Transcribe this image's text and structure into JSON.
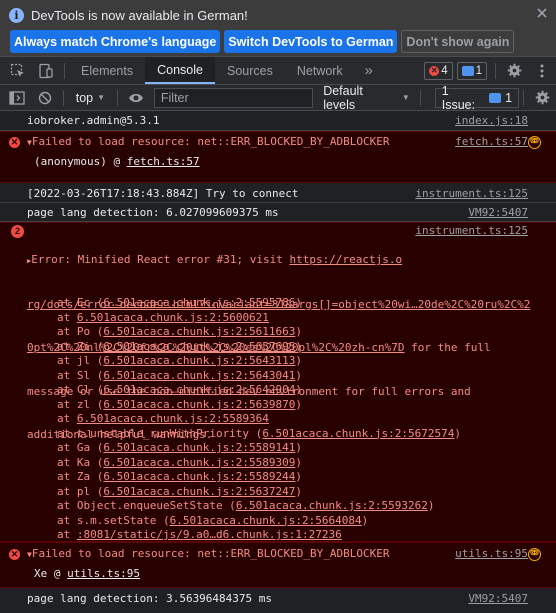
{
  "infobar": {
    "message": "DevTools is now available in German!",
    "buttons": [
      "Always match Chrome's language",
      "Switch DevTools to German",
      "Don't show again"
    ]
  },
  "tabs": [
    "Elements",
    "Console",
    "Sources",
    "Network"
  ],
  "badges": {
    "errors": "4",
    "messages": "1"
  },
  "toolbar": {
    "context": "top",
    "filter_placeholder": "Filter",
    "levels": "Default levels",
    "issues_label": "1 Issue:",
    "issues_count": "1"
  },
  "messages": {
    "m1": {
      "text": "iobroker.admin@5.3.1",
      "src": "index.js:18"
    },
    "m2": {
      "text": "Failed to load resource: net::ERR_BLOCKED_BY_ADBLOCKER",
      "src": "fetch.ts:57",
      "line2a": "(anonymous) @ ",
      "line2b": "fetch.ts:57"
    },
    "m3": {
      "text": "[2022-03-26T17:18:43.884Z] Try to connect",
      "src": "instrument.ts:125"
    },
    "m4": {
      "text": "page lang detection: 6.027099609375 ms",
      "src": "VM92:5407"
    },
    "m5": {
      "count": "2",
      "prefix": "Error: Minified React error #31; visit ",
      "url1": "https://reactjs.o",
      "src": "instrument.ts:125",
      "url2": "rg/docs/error-decoder.html?invariant=31&args[]=object%20wi…20de%2C%20ru%2C%2",
      "url3": "0pt%2C%20nl%2C%20fr%2C%20it%2C%20es%2C%20pl%2C%20zh-cn%7D",
      "rest1": " for the full",
      "rest2": "message or use the non-minified dev environment for full errors and",
      "rest3": "additional helpful warnings.",
      "stack": [
        [
          "at Ec (",
          "6.501acaca.chunk.js:2:5595786",
          ")"
        ],
        [
          "at ",
          "6.501acaca.chunk.js:2:5600621",
          ""
        ],
        [
          "at Po (",
          "6.501acaca.chunk.js:2:5611663",
          ")"
        ],
        [
          "at Zi (",
          "6.501acaca.chunk.js:2:5657695",
          ")"
        ],
        [
          "at jl (",
          "6.501acaca.chunk.js:2:5643113",
          ")"
        ],
        [
          "at Sl (",
          "6.501acaca.chunk.js:2:5643041",
          ")"
        ],
        [
          "at Cl (",
          "6.501acaca.chunk.js:2:5642904",
          ")"
        ],
        [
          "at zl (",
          "6.501acaca.chunk.js:2:5639870",
          ")"
        ],
        [
          "at ",
          "6.501acaca.chunk.js:2:5589364",
          ""
        ],
        [
          "at t.unstable_runWithPriority (",
          "6.501acaca.chunk.js:2:5672574",
          ")"
        ],
        [
          "at Ga (",
          "6.501acaca.chunk.js:2:5589141",
          ")"
        ],
        [
          "at Ka (",
          "6.501acaca.chunk.js:2:5589309",
          ")"
        ],
        [
          "at Za (",
          "6.501acaca.chunk.js:2:5589244",
          ")"
        ],
        [
          "at pl (",
          "6.501acaca.chunk.js:2:5637247",
          ")"
        ],
        [
          "at Object.enqueueSetState (",
          "6.501acaca.chunk.js:2:5593262",
          ")"
        ],
        [
          "at s.m.setState (",
          "6.501acaca.chunk.js:2:5664084",
          ")"
        ],
        [
          "at ",
          ":8081/static/js/9.a0…d6.chunk.js:1:27236",
          ""
        ]
      ]
    },
    "m6": {
      "text": "Failed to load resource: net::ERR_BLOCKED_BY_ADBLOCKER",
      "src": "utils.ts:95",
      "line2a": "Xe @ ",
      "line2b": "utils.ts:95"
    },
    "m7": {
      "text": "page lang detection: 3.56396484375 ms",
      "src": "VM92:5407"
    }
  },
  "icons": [
    "info-icon",
    "close-icon",
    "pointer-icon",
    "device-icon",
    "more-tabs-icon",
    "gear-icon",
    "more-icon",
    "sidebar-icon",
    "clear-icon",
    "eye-icon",
    "error-icon",
    "adblock-icon"
  ]
}
